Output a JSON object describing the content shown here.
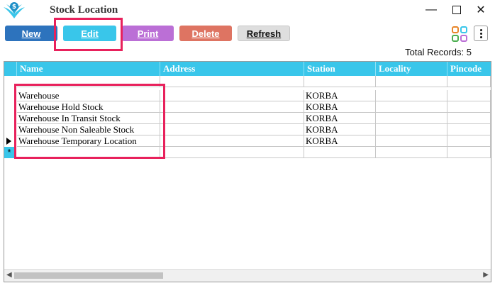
{
  "window": {
    "title": "Stock Location"
  },
  "toolbar": {
    "new": "New",
    "edit": "Edit",
    "print": "Print",
    "delete": "Delete",
    "refresh": "Refresh"
  },
  "colors": {
    "new": "#2d73bd",
    "edit": "#39c6ea",
    "print": "#bb6fd6",
    "delete": "#de7462",
    "refresh": "#dedede",
    "header": "#39c6ea",
    "highlight": "#e8215c"
  },
  "total_records": "Total Records: 5",
  "grid": {
    "columns": [
      "Name",
      "Address",
      "Station",
      "Locality",
      "Pincode"
    ],
    "rows": [
      [
        "Warehouse",
        "",
        "KORBA",
        "",
        ""
      ],
      [
        "Warehouse Hold Stock",
        "",
        "KORBA",
        "",
        ""
      ],
      [
        "Warehouse In Transit Stock",
        "",
        "KORBA",
        "",
        ""
      ],
      [
        "Warehouse Non Saleable Stock",
        "",
        "KORBA",
        "",
        ""
      ],
      [
        "Warehouse Temporary Location",
        "",
        "KORBA",
        "",
        ""
      ]
    ],
    "new_row_marker": "*"
  },
  "icons": {
    "logo": "app-logo-icon",
    "minimize": "minimize-icon",
    "maximize": "maximize-icon",
    "close": "close-icon",
    "apps": "apps-grid-icon",
    "more": "more-vertical-icon",
    "current_row": "current-row-arrow-icon"
  }
}
